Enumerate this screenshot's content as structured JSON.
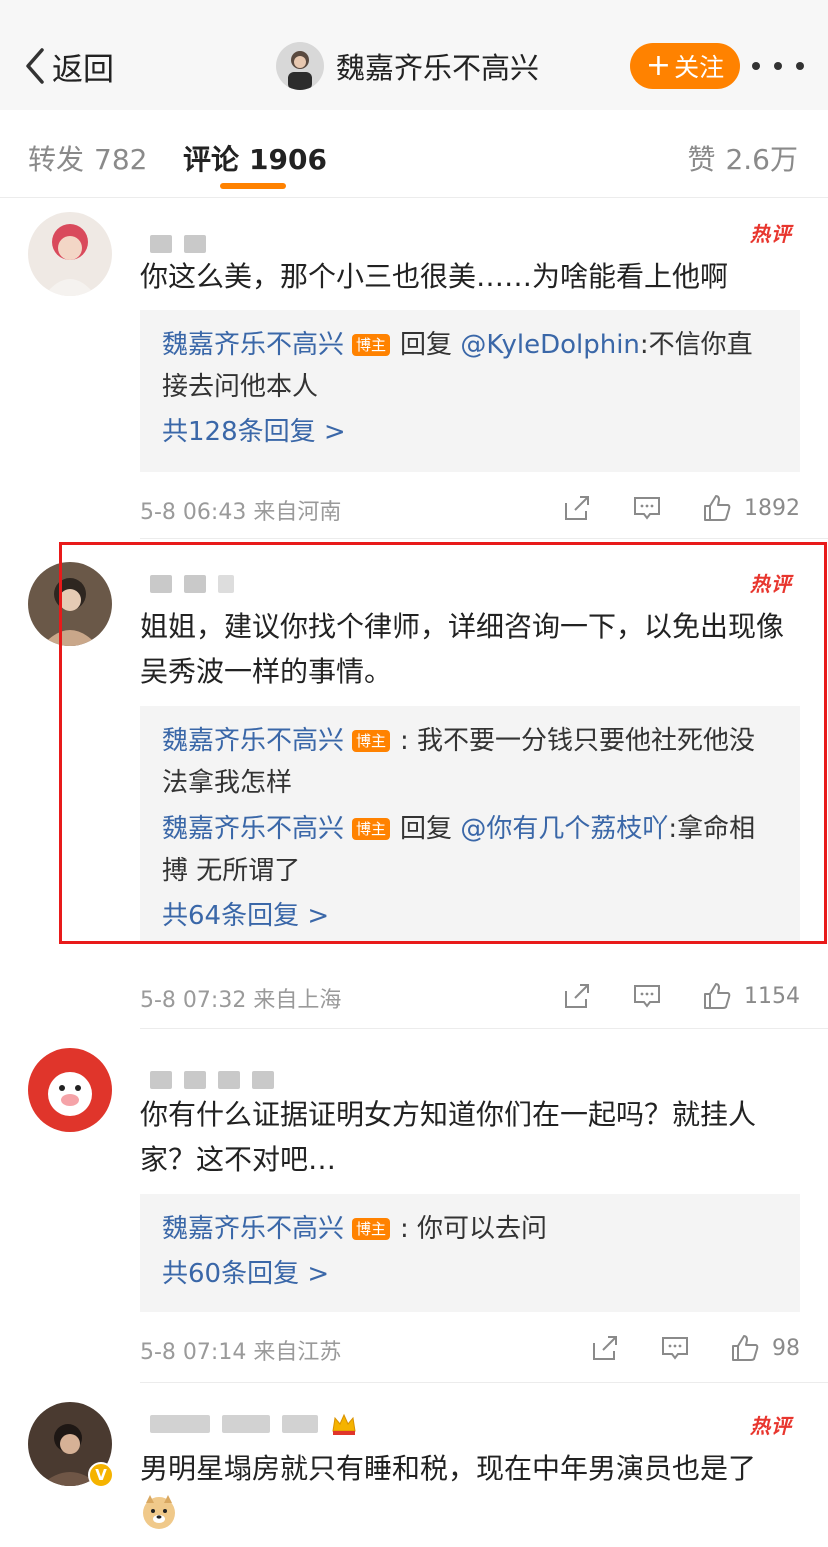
{
  "nav": {
    "back_label": "返回",
    "title": "魏嘉齐乐不高兴",
    "follow_label": "关注"
  },
  "tabs": {
    "repost": {
      "label": "转发",
      "count": "782"
    },
    "comment": {
      "label": "评论",
      "count": "1906"
    },
    "like": {
      "label": "赞",
      "count": "2.6万"
    }
  },
  "hot_label": "热评",
  "author_badge": "博主",
  "comments": [
    {
      "text": "你这么美，那个小三也很美……为啥能看上他啊",
      "replies": [
        {
          "name": "魏嘉齐乐不高兴",
          "prefix": "回复",
          "at": "@KyleDolphin",
          "text": ":不信你直接去问他本人"
        }
      ],
      "more_replies": "共128条回复 >",
      "time": "5-8 06:43",
      "location": "来自河南",
      "likes": "1892"
    },
    {
      "text": "姐姐，建议你找个律师，详细咨询一下，以免出现像吴秀波一样的事情。",
      "replies": [
        {
          "name": "魏嘉齐乐不高兴",
          "prefix": "",
          "at": "",
          "text": ": 我不要一分钱只要他社死他没法拿我怎样"
        },
        {
          "name": "魏嘉齐乐不高兴",
          "prefix": "回复",
          "at": "@你有几个荔枝吖",
          "text": ":拿命相搏 无所谓了"
        }
      ],
      "more_replies": "共64条回复 >",
      "time": "5-8 07:32",
      "location": "来自上海",
      "likes": "1154"
    },
    {
      "text": "你有什么证据证明女方知道你们在一起吗？就挂人家？这不对吧…",
      "replies": [
        {
          "name": "魏嘉齐乐不高兴",
          "prefix": "",
          "at": "",
          "text": ": 你可以去问"
        }
      ],
      "more_replies": "共60条回复 >",
      "time": "5-8 07:14",
      "location": "来自江苏",
      "likes": "98"
    },
    {
      "text": "男明星塌房就只有睡和税，现在中年男演员也是了"
    }
  ]
}
